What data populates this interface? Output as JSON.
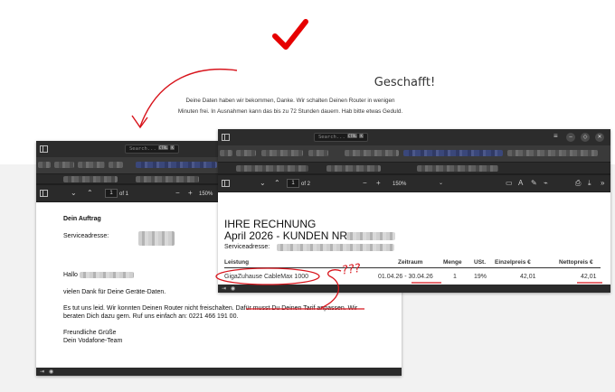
{
  "confirmation": {
    "title": "Geschafft!",
    "message": "Deine Daten haben wir bekommen, Danke. Wir schalten Deinen Router in wenigen Minuten frei. In Ausnahmen kann das bis zu 72 Stunden dauern. Hab bitte etwas Geduld."
  },
  "left_viewer": {
    "search_placeholder": "Search...",
    "search_shortcut": "CTRL",
    "search_key": "K",
    "page_current": "1",
    "page_total": "of 1",
    "zoom": "150%",
    "letter": {
      "heading": "Dein Auftrag",
      "service_address_label": "Serviceadresse:",
      "greeting": "Hallo",
      "line1": "vielen Dank für Deine Geräte-Daten.",
      "para_a": "Es tut uns leid. Wir konnten Deinen Router nicht freischalten.",
      "para_b": "Dafür musst Du Deinen Tarif anpassen.",
      "para_c": "Wir",
      "para_d": "beraten Dich dazu gern. Ruf uns einfach an: 0221 466 191 00.",
      "closing1": "Freundliche Grüße",
      "closing2": "Dein Vodafone-Team"
    }
  },
  "right_viewer": {
    "search_placeholder": "Search...",
    "search_shortcut": "CTRL",
    "search_key": "K",
    "page_current": "1",
    "page_total": "of 2",
    "zoom": "150%",
    "invoice": {
      "title": "IHRE RECHNUNG",
      "subtitle": "April 2026 - KUNDEN NR.",
      "service_address_label": "Serviceadresse:",
      "columns": [
        "Leistung",
        "Zeitraum",
        "Menge",
        "USt.",
        "Einzelpreis €",
        "Nettopreis €"
      ],
      "row": {
        "service": "GigaZuhause CableMax 1000",
        "period_start": "01.04.26",
        "period_sep": " - ",
        "period_end": "30.04.26",
        "qty": "1",
        "vat": "19%",
        "unit_price": "42,01",
        "net_price": "42,01"
      }
    }
  },
  "annotation": {
    "question_marks": "???"
  },
  "colors": {
    "check_red": "#e60000",
    "annotation_red": "#d8141c",
    "viewer_dark": "#2c2c2c"
  },
  "icons": [
    "checkmark-icon",
    "sidebar-toggle-icon",
    "menu-icon",
    "minimize-icon",
    "maximize-icon",
    "close-icon",
    "zoom-out-icon",
    "zoom-in-icon",
    "download-icon",
    "print-icon"
  ]
}
